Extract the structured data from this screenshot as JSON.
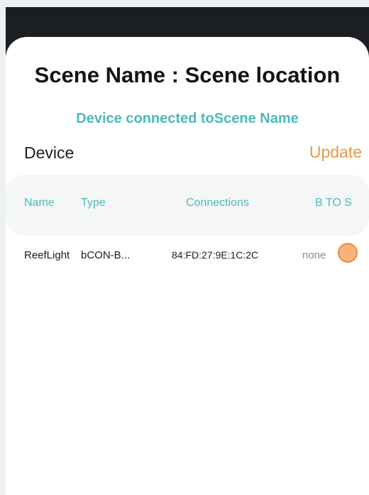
{
  "header": {
    "title": "Scene Name : Scene location",
    "subtitle": "Device connected toScene Name"
  },
  "section": {
    "label": "Device",
    "update_label": "Update"
  },
  "table": {
    "columns": {
      "name": "Name",
      "type": "Type",
      "connections": "Connections",
      "b_to_s": "B TO S"
    },
    "rows": [
      {
        "name": "ReefLight",
        "type": "bCON-B...",
        "connections": "84:FD:27:9E:1C:2C",
        "b_to_s": "none"
      }
    ]
  },
  "colors": {
    "accent_teal": "#4db8bf",
    "accent_orange": "#e49a46",
    "toggle_fill": "#f9b27a"
  }
}
